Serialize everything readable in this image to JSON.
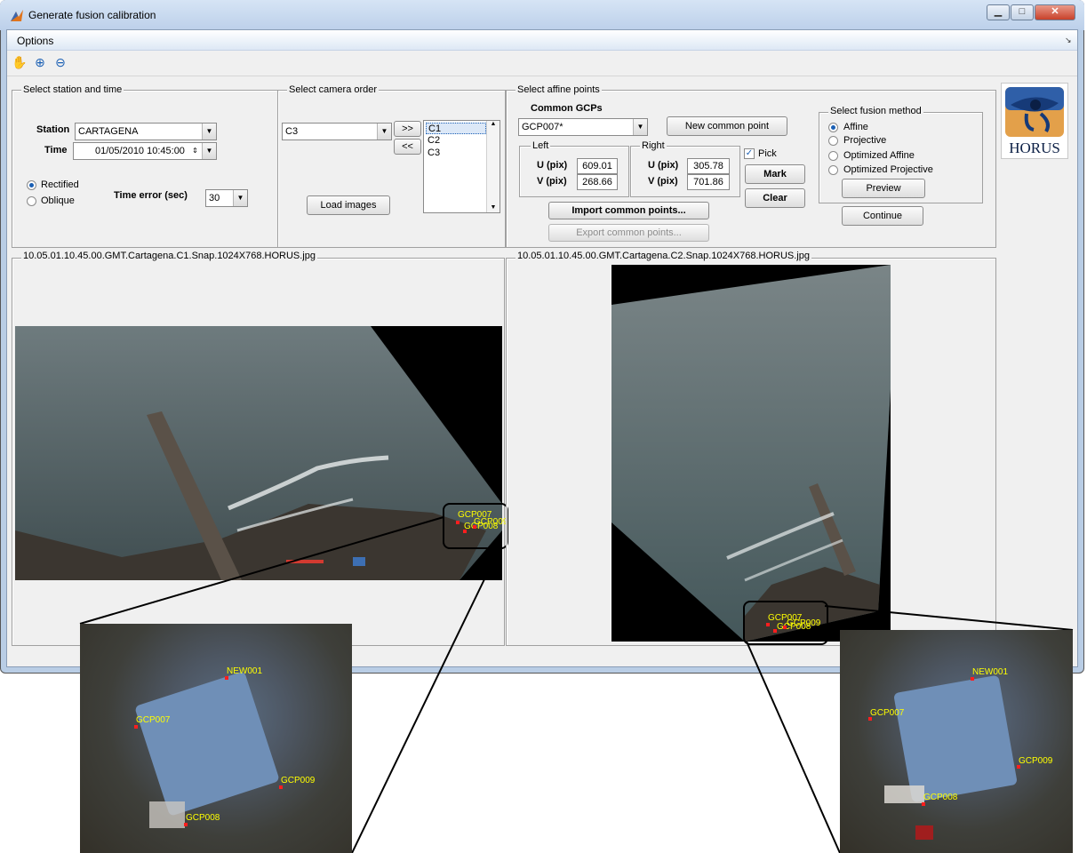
{
  "window": {
    "title": "Generate fusion calibration",
    "controls": {
      "minimize": "▁",
      "maximize": "□",
      "close": "✕"
    }
  },
  "menu": {
    "options": "Options"
  },
  "toolbar": {
    "icons": [
      "hand-icon",
      "zoom-in-icon",
      "zoom-out-icon"
    ],
    "pan": "✋",
    "zoom_in": "⊕",
    "zoom_out": "⊖"
  },
  "station_time": {
    "title": "Select station and time",
    "station_label": "Station",
    "station_value": "CARTAGENA",
    "time_label": "Time",
    "time_value": "01/05/2010 10:45:00",
    "rectified_label": "Rectified",
    "oblique_label": "Oblique",
    "time_error_label": "Time error (sec)",
    "time_error_value": "30"
  },
  "camera_order": {
    "title": "Select camera order",
    "camera_value": "C3",
    "add_label": ">>",
    "remove_label": "<<",
    "load_label": "Load images",
    "list": [
      "C1",
      "C2",
      "C3"
    ]
  },
  "affine_points": {
    "title": "Select affine points",
    "common_gcps_label": "Common GCPs",
    "gcp_value": "GCP007*",
    "new_common_point_label": "New common point",
    "left_label": "Left",
    "right_label": "Right",
    "u_label": "U (pix)",
    "v_label": "V (pix)",
    "left_u": "609.01",
    "left_v": "268.66",
    "right_u": "305.78",
    "right_v": "701.86",
    "pick_label": "Pick",
    "mark_label": "Mark",
    "clear_label": "Clear",
    "import_label": "Import common points...",
    "export_label": "Export common points..."
  },
  "fusion_method": {
    "title": "Select fusion method",
    "options": [
      "Affine",
      "Projective",
      "Optimized Affine",
      "Optimized Projective"
    ],
    "selected": "Affine",
    "preview_label": "Preview",
    "continue_label": "Continue"
  },
  "logo": {
    "text": "HORUS"
  },
  "images": {
    "left_title": "10.05.01.10.45.00.GMT.Cartagena.C1.Snap.1024X768.HORUS.jpg",
    "right_title": "10.05.01.10.45.00.GMT.Cartagena.C2.Snap.1024X768.HORUS.jpg"
  },
  "markers": {
    "left_main": [
      "GCP007",
      "GCP009",
      "GCP008"
    ],
    "right_main": [
      "GCP007",
      "GCP009",
      "GCP008"
    ],
    "left_zoom": [
      "NEW001",
      "GCP007",
      "GCP009",
      "GCP008"
    ],
    "right_zoom": [
      "NEW001",
      "GCP007",
      "GCP009",
      "GCP008"
    ]
  },
  "colors": {
    "marker_text": "#ffff00",
    "marker_dot": "#ff1e1e",
    "selection": "#1a5fb4"
  }
}
